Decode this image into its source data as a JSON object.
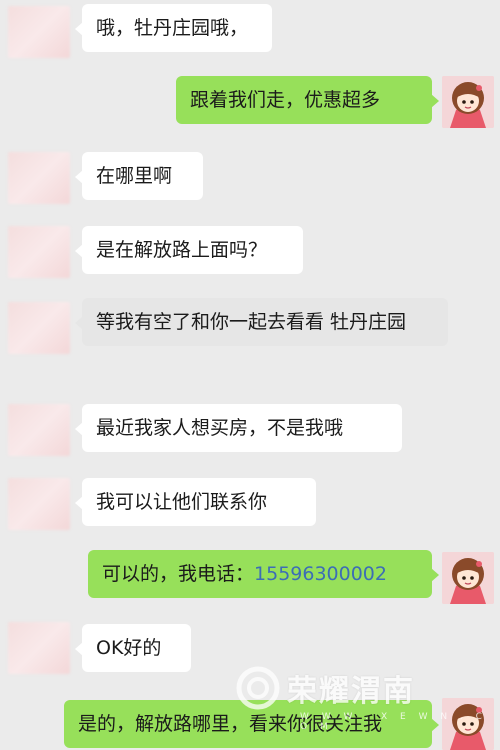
{
  "messages": [
    {
      "side": "left",
      "text": "哦，牡丹庄园哦，"
    },
    {
      "side": "right",
      "text": "跟着我们走，优惠超多"
    },
    {
      "side": "left",
      "text": "在哪里啊"
    },
    {
      "side": "left",
      "text": "是在解放路上面吗？"
    },
    {
      "side": "left",
      "text": "等我有空了和你一起去看看 牡丹庄园"
    },
    {
      "side": "left",
      "text": "最近我家人想买房，不是我哦"
    },
    {
      "side": "left",
      "text": "我可以让他们联系你"
    },
    {
      "side": "right",
      "text_prefix": "可以的，我电话：",
      "phone": "15596300002"
    },
    {
      "side": "left",
      "text": "OK好的"
    },
    {
      "side": "right",
      "text": "是的，解放路哪里，看来你很关注我"
    }
  ],
  "watermark": {
    "text": "荣耀渭南",
    "sub": "W W W . X E W N . C O M",
    "logo": "weibo-style-swirl-icon"
  },
  "colors": {
    "background": "#ebebeb",
    "left_bubble": "#ffffff",
    "left_bubble_pressed": "#e6e6e6",
    "right_bubble": "#97e05a",
    "phone_link": "#3c6db6"
  }
}
